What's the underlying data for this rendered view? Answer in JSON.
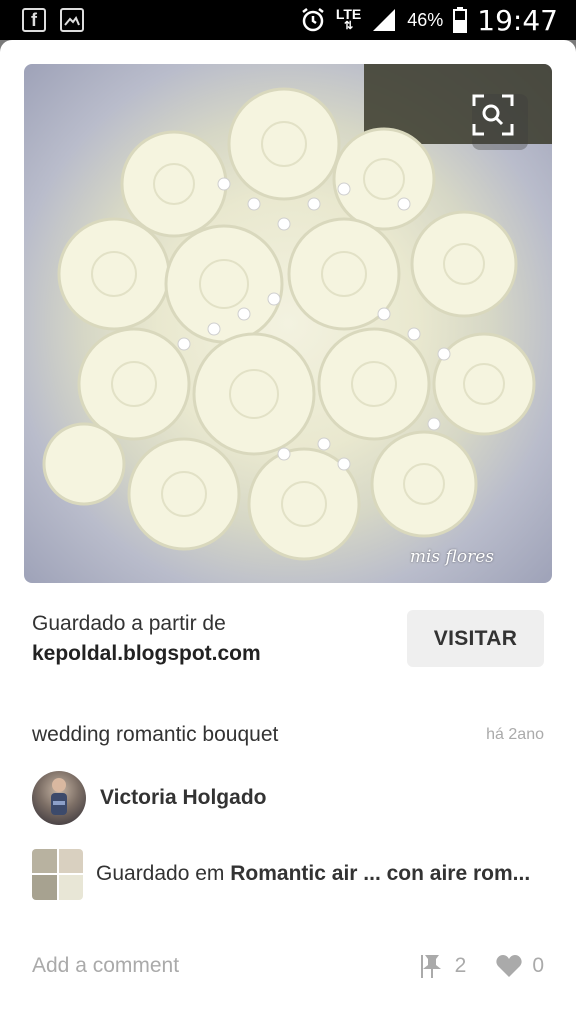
{
  "status_bar": {
    "lte": "LTE",
    "battery": "46%",
    "time": "19:47",
    "icons": [
      "facebook-icon",
      "image-icon",
      "alarm-icon",
      "signal-icon",
      "battery-icon"
    ]
  },
  "pin": {
    "watermark": "mis flores",
    "saved_from_label": "Guardado a partir de",
    "source_domain": "kepoldal.blogspot.com",
    "visit_label": "VISITAR",
    "description": "wedding romantic bouquet",
    "age": "há 2ano",
    "user_name": "Victoria Holgado",
    "board_prefix": "Guardado em ",
    "board_name": "Romantic air ... con aire rom...",
    "comment_placeholder": "Add a comment",
    "repin_count": "2",
    "like_count": "0"
  },
  "colors": {
    "statusbar_bg": "#000000",
    "card_bg": "#ffffff",
    "visit_bg": "#efefef",
    "muted_text": "#aaaaaa"
  }
}
